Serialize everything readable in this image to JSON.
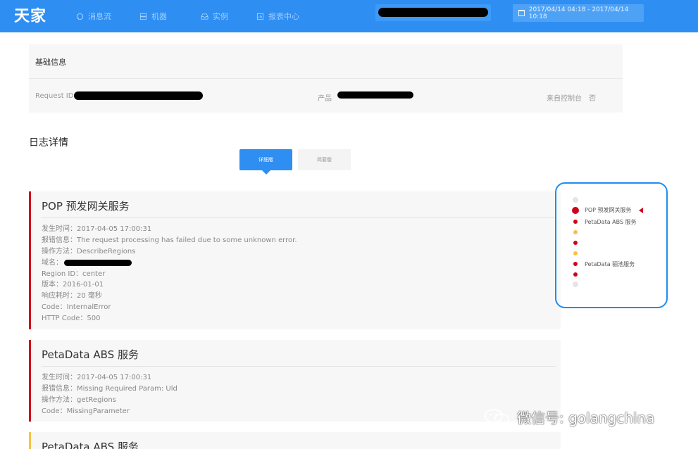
{
  "app": {
    "logo": "天家"
  },
  "nav": [
    {
      "label": "消息流",
      "icon": "chat-icon"
    },
    {
      "label": "机器",
      "icon": "server-icon"
    },
    {
      "label": "实例",
      "icon": "inbox-icon"
    },
    {
      "label": "报表中心",
      "icon": "report-icon"
    }
  ],
  "date_range": {
    "value": "2017/04/14 04:18 - 2017/04/14 10:18",
    "icon": "calendar-icon"
  },
  "basic_info": {
    "title": "基础信息",
    "request_id_label": "Request ID",
    "product_label": "产品",
    "from_console_label": "来自控制台",
    "from_console_value": "否"
  },
  "log_section": {
    "title": "日志详情",
    "toggle_active": "详细版",
    "toggle_inactive": "简要版"
  },
  "logs": [
    {
      "title": "POP 预发网关服务",
      "fields": [
        "发生时间：2017-04-05 17:00:31",
        "报错信息：The request processing has failed due to some unknown error.",
        "操作方法：DescribeRegions",
        "域名：",
        "Region ID：center",
        "版本：2016-01-01",
        "响应耗时：20 毫秒",
        "Code：InternalError",
        "HTTP Code：500"
      ]
    },
    {
      "title": "PetaData ABS 服务",
      "fields": [
        "发生时间：2017-04-05 17:00:31",
        "报错信息：Missing Required Param: Uld",
        "操作方法：getRegions",
        "Code：MissingParameter"
      ]
    },
    {
      "title": "PetaData ABS 服务",
      "fields": []
    }
  ],
  "timeline": {
    "labels": [
      "POP 预发网关服务",
      "PetaData ABS 服务",
      "PetaData 骊池服务"
    ]
  },
  "watermark": {
    "text": "微信号: golangchina"
  },
  "colors": {
    "accent": "#2e8ef2",
    "error": "#d0021b",
    "warning": "#f5c242"
  }
}
